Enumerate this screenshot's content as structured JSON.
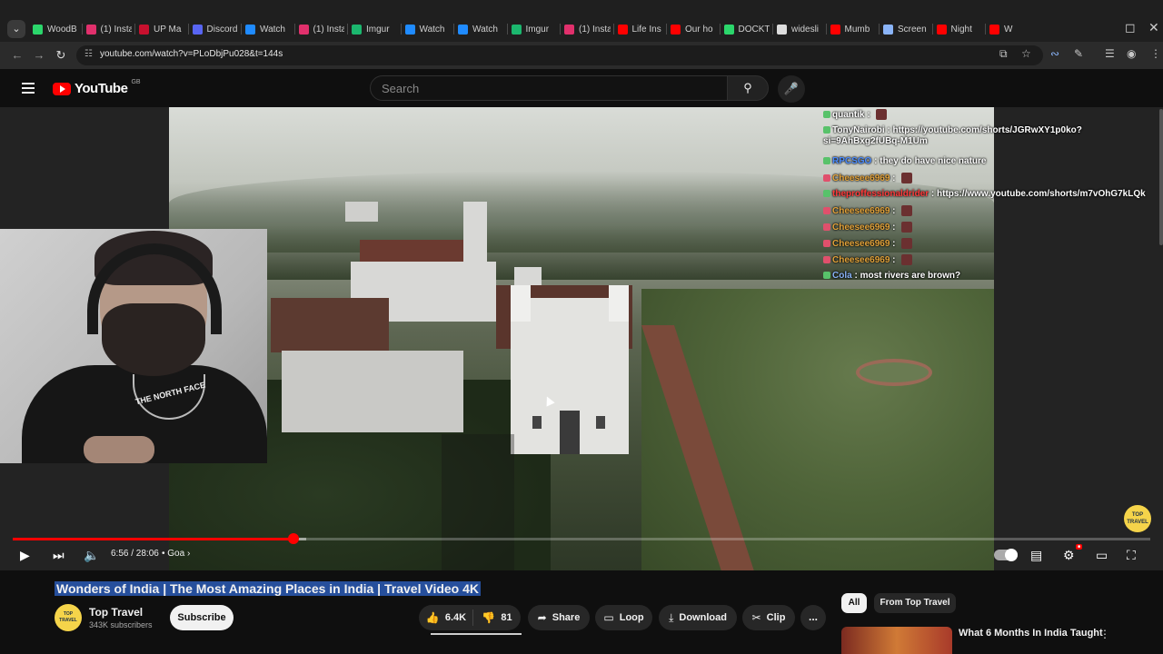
{
  "browser": {
    "tabs": [
      {
        "label": "WoodB",
        "color": "#2bd66b"
      },
      {
        "label": "(1) Insta",
        "color": "#e1306c"
      },
      {
        "label": "UP Ma",
        "color": "#c8102e"
      },
      {
        "label": "Discord",
        "color": "#5865f2"
      },
      {
        "label": "Watch",
        "color": "#1f8bff"
      },
      {
        "label": "(1) Insta",
        "color": "#e1306c"
      },
      {
        "label": "Imgur",
        "color": "#1bb76e"
      },
      {
        "label": "Watch",
        "color": "#1f8bff"
      },
      {
        "label": "Watch",
        "color": "#1f8bff"
      },
      {
        "label": "Imgur",
        "color": "#1bb76e"
      },
      {
        "label": "(1) Insta",
        "color": "#e1306c"
      },
      {
        "label": "Life Ins",
        "color": "#ff0000"
      },
      {
        "label": "Our ho",
        "color": "#ff0000"
      },
      {
        "label": "DOCKT",
        "color": "#2bd66b"
      },
      {
        "label": "widesli",
        "color": "#dddddd"
      },
      {
        "label": "Mumb",
        "color": "#ff0000"
      },
      {
        "label": "Screen",
        "color": "#8ab4f8"
      },
      {
        "label": "Night",
        "color": "#ff0000"
      },
      {
        "label": "W",
        "color": "#ff0000"
      }
    ],
    "url": "youtube.com/watch?v=PLoDbjPu028&t=144s"
  },
  "youtube": {
    "logo_text": "YouTube",
    "country": "GB",
    "search_placeholder": "Search"
  },
  "player": {
    "current_time": "6:56",
    "duration": "28:06",
    "time_display": "6:56 / 28:06",
    "chapter": "Goa",
    "progress_fraction": 0.247,
    "buffer_fraction": 0.258,
    "webcam_logo": "THE NORTH FACE",
    "watermark": "TOP TRAVEL"
  },
  "chat": [
    {
      "user": "quantik",
      "text": "",
      "color": "#ffffff"
    },
    {
      "user": "TonyNairobi",
      "text": "https://youtube.com/shorts/JGRwXY1p0ko?si=9AhBxg2fUBq-M1Um",
      "color": "#ffffff"
    },
    {
      "user": "RPCSGO",
      "text": "they do have nice nature",
      "color": "#4b8cff"
    },
    {
      "user": "Cheesee6969",
      "text": "",
      "color": "#e2a23a"
    },
    {
      "user": "theproffessionaldrider",
      "text": "https://www.youtube.com/shorts/m7vOhG7kLQk",
      "color": "#ff3b3b"
    },
    {
      "user": "Cheesee6969",
      "text": "",
      "color": "#e2a23a"
    },
    {
      "user": "Cheesee6969",
      "text": "",
      "color": "#e2a23a"
    },
    {
      "user": "Cheesee6969",
      "text": "",
      "color": "#e2a23a"
    },
    {
      "user": "Cheesee6969",
      "text": "",
      "color": "#e2a23a"
    },
    {
      "user": "Cola",
      "text": "most rivers are brown?",
      "color": "#8ab4f8"
    }
  ],
  "video": {
    "title": "Wonders of India | The Most Amazing Places in India | Travel Video 4K",
    "channel": "Top Travel",
    "subscribers": "343K subscribers",
    "subscribe_label": "Subscribe",
    "likes": "6.4K",
    "dislikes": "81",
    "share_label": "Share",
    "loop_label": "Loop",
    "download_label": "Download",
    "clip_label": "Clip",
    "more_label": "..."
  },
  "sidebar": {
    "chips": [
      "All",
      "From Top Travel"
    ],
    "recommended_title": "What 6 Months In India Taught"
  },
  "colors": {
    "accent": "#ff0000",
    "background": "#0f0f0f",
    "selection": "#264f9c"
  }
}
